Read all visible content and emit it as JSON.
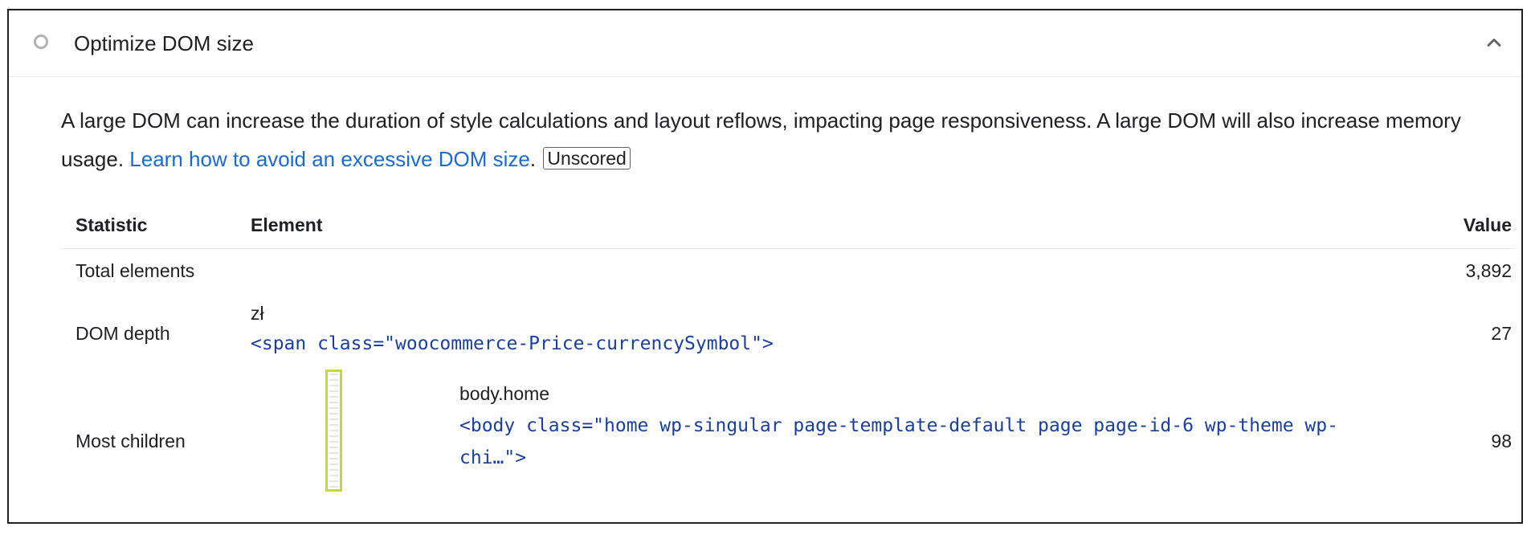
{
  "audit": {
    "title": "Optimize DOM size",
    "description_text": "A large DOM can increase the duration of style calculations and layout reflows, impacting page responsiveness. A large DOM will also increase memory usage. ",
    "link_text": "Learn how to avoid an excessive DOM size",
    "after_link": ".",
    "badge": "Unscored"
  },
  "table": {
    "headers": {
      "statistic": "Statistic",
      "element": "Element",
      "value": "Value"
    },
    "rows": [
      {
        "statistic": "Total elements",
        "element_label": "",
        "element_code": "",
        "value": "3,892"
      },
      {
        "statistic": "DOM depth",
        "element_label": "zł",
        "element_code": "<span class=\"woocommerce-Price-currencySymbol\">",
        "value": "27"
      },
      {
        "statistic": "Most children",
        "element_label": "body.home",
        "element_code_line1": "<body class=\"home wp-singular page-template-default page page-id-6 wp-theme wp-",
        "element_code_line2": "chi…\">",
        "value": "98"
      }
    ]
  },
  "colors": {
    "link": "#1a6ad8",
    "code": "#1a3fa0",
    "thumb_border": "#c6d93a"
  },
  "icons": {
    "status": "unscored-circle-icon",
    "toggle": "chevron-up-icon"
  }
}
